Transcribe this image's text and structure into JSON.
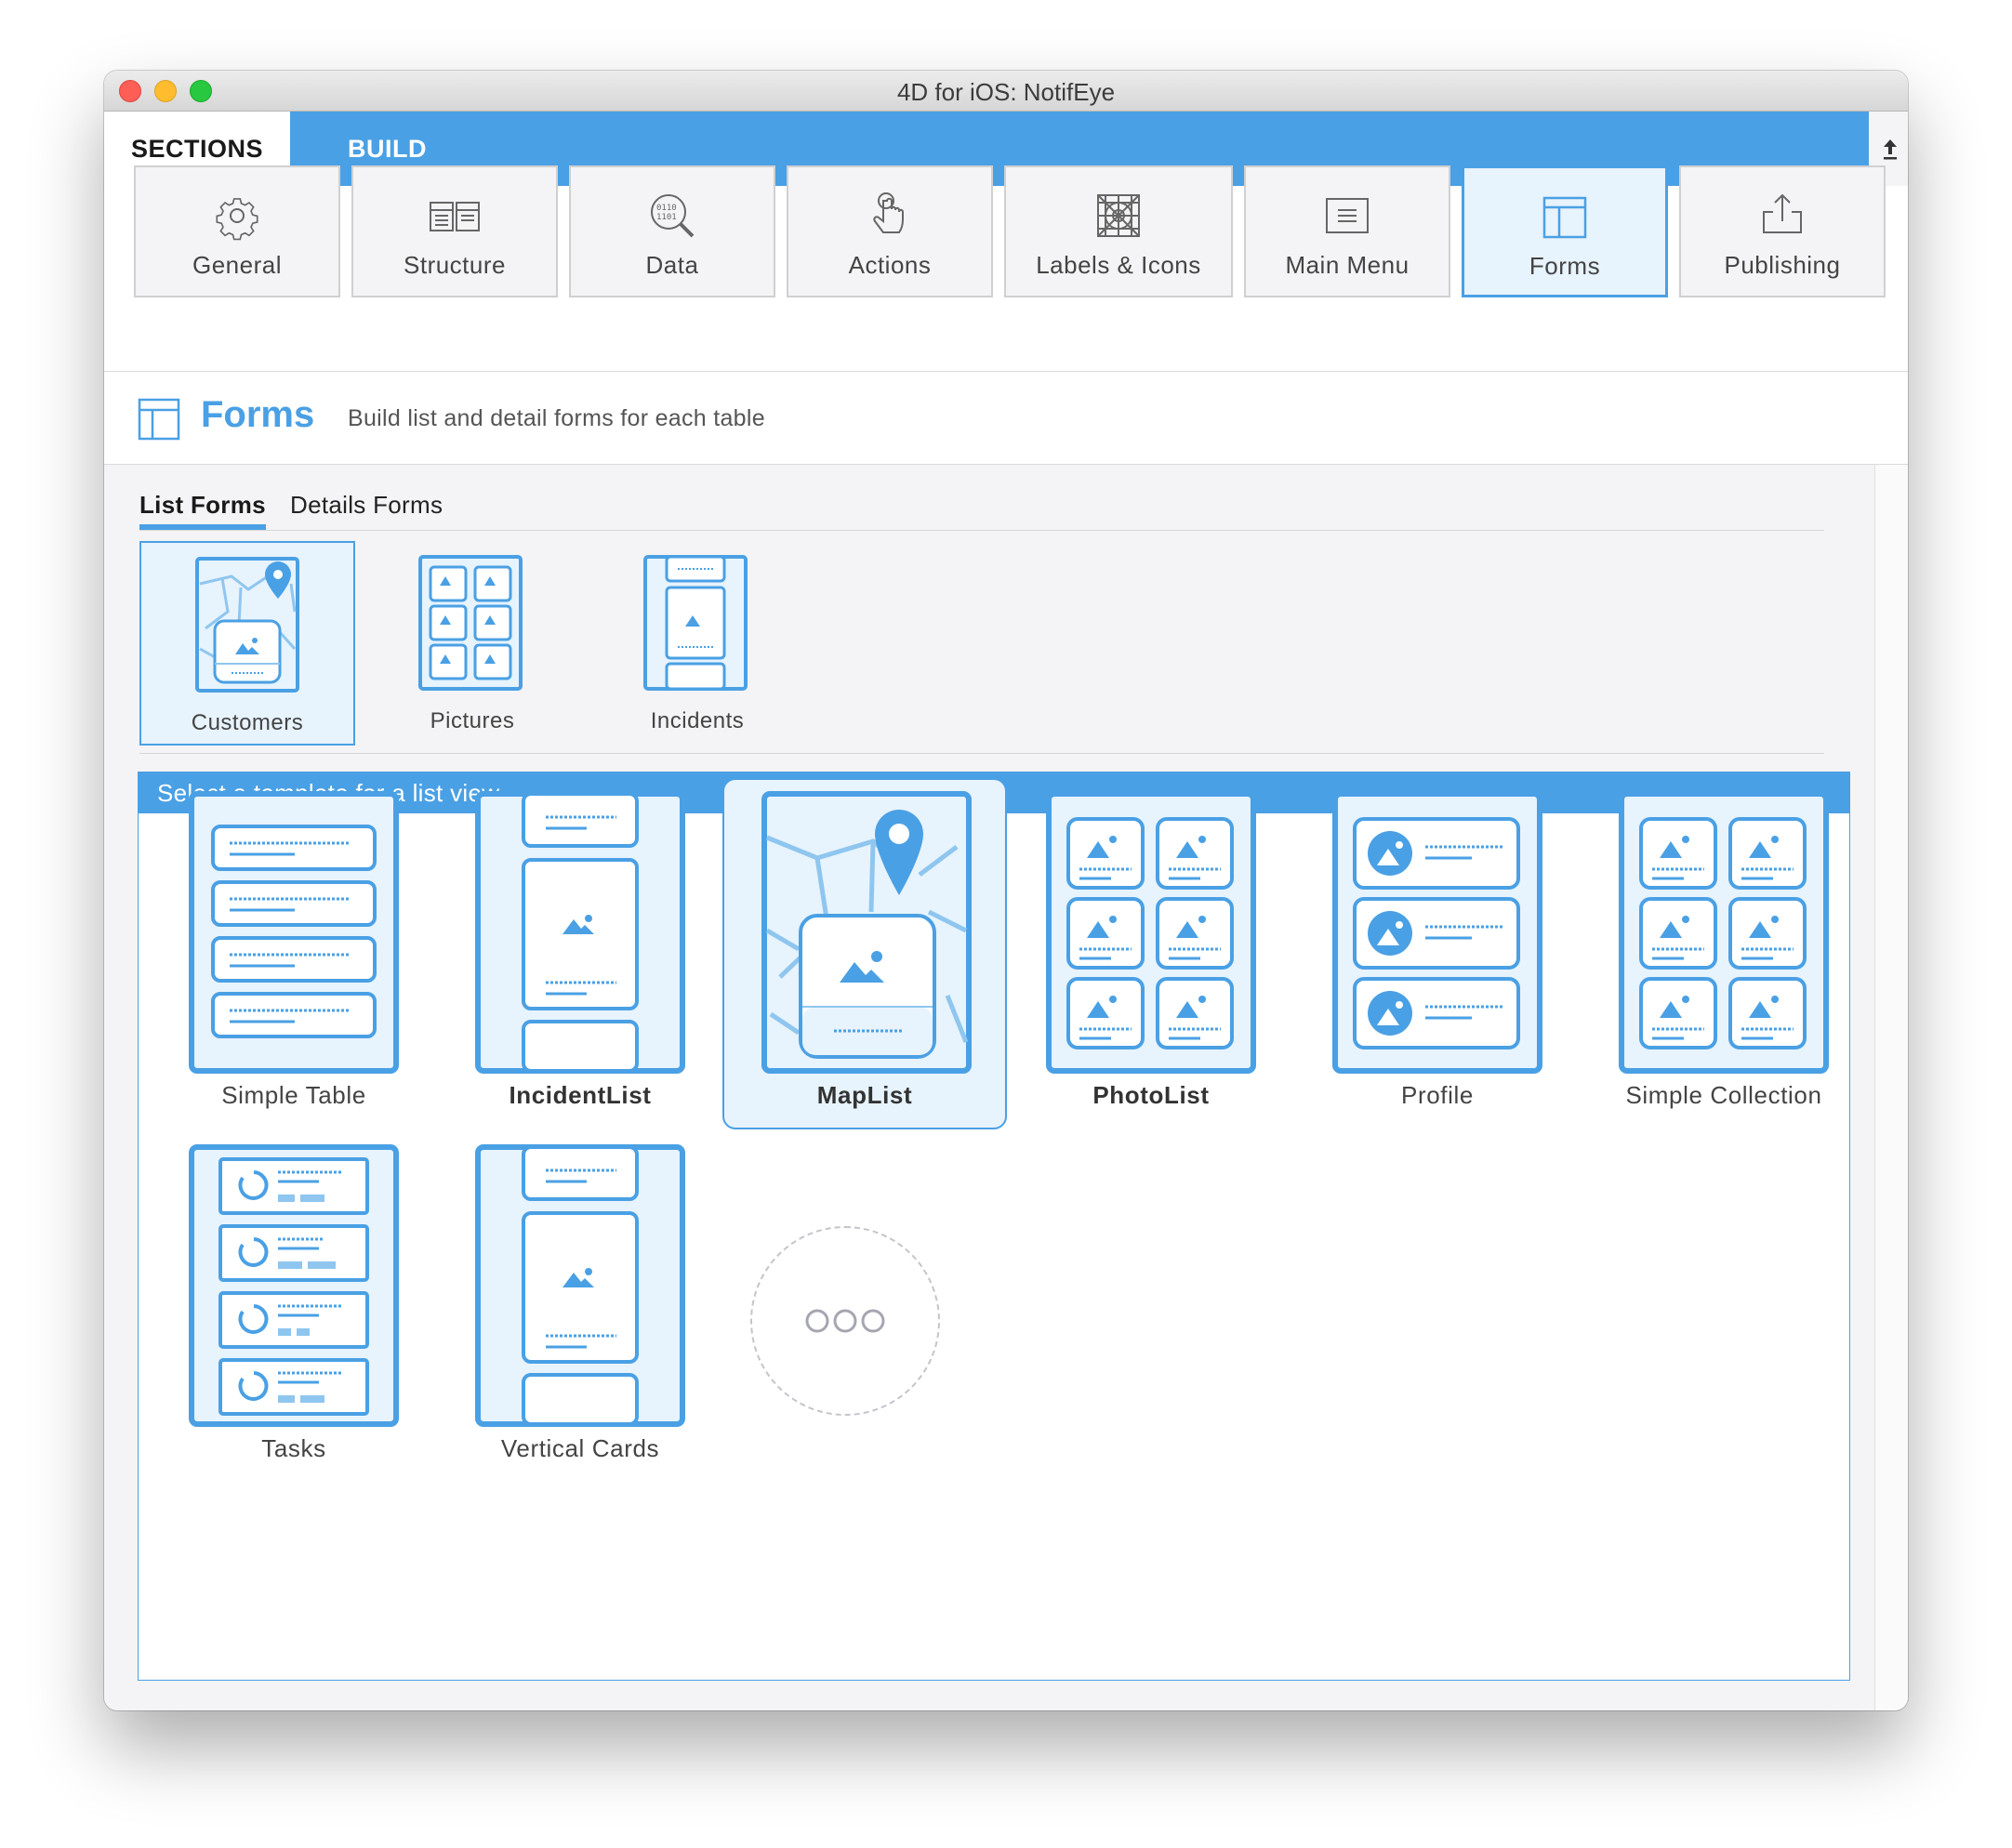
{
  "window": {
    "title": "4D for iOS: NotifEye"
  },
  "tabs": {
    "sections": "SECTIONS",
    "build": "BUILD"
  },
  "toolbar": [
    {
      "label": "General",
      "icon": "gear-icon"
    },
    {
      "label": "Structure",
      "icon": "structure-icon"
    },
    {
      "label": "Data",
      "icon": "data-icon"
    },
    {
      "label": "Actions",
      "icon": "hand-pointer-icon"
    },
    {
      "label": "Labels & Icons",
      "icon": "labels-icons-icon"
    },
    {
      "label": "Main Menu",
      "icon": "menu-icon"
    },
    {
      "label": "Forms",
      "icon": "forms-icon",
      "active": true
    },
    {
      "label": "Publishing",
      "icon": "share-icon"
    }
  ],
  "header": {
    "title": "Forms",
    "description": "Build list and detail forms for each table"
  },
  "subtabs": {
    "list": "List Forms",
    "details": "Details Forms"
  },
  "tables": [
    {
      "label": "Customers",
      "selected": true
    },
    {
      "label": "Pictures"
    },
    {
      "label": "Incidents"
    }
  ],
  "panel": {
    "title": "Select a template for a list view"
  },
  "templates": [
    {
      "label": "Simple Table"
    },
    {
      "label": "IncidentList"
    },
    {
      "label": "MapList",
      "selected": true
    },
    {
      "label": "PhotoList"
    },
    {
      "label": "Profile"
    },
    {
      "label": "Simple Collection"
    },
    {
      "label": "Tasks"
    },
    {
      "label": "Vertical Cards"
    }
  ],
  "colors": {
    "accent": "#4aa0e4",
    "light_accent": "#e7f3fd"
  }
}
